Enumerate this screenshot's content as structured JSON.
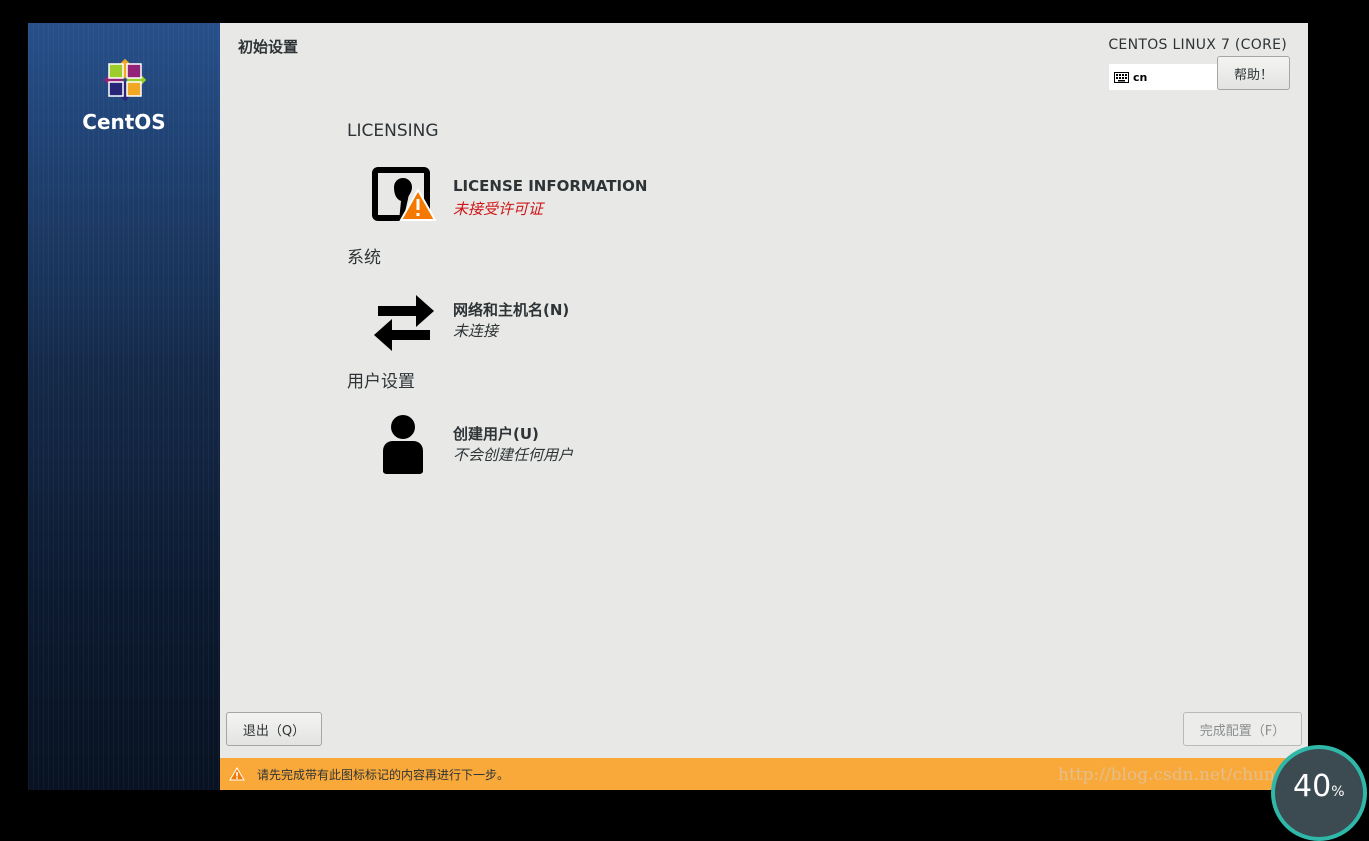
{
  "sidebar": {
    "logo_text": "CentOS"
  },
  "header": {
    "title": "初始设置",
    "distro": "CENTOS LINUX 7 (CORE)",
    "keyboard_layout": "cn",
    "help_label": "帮助！"
  },
  "categories": [
    {
      "title": "LICENSING",
      "spokes": [
        {
          "title": "LICENSE INFORMATION",
          "status": "未接受许可证",
          "icon": "license-warning-icon"
        }
      ]
    },
    {
      "title": "系统",
      "spokes": [
        {
          "title": "网络和主机名(N)",
          "status": "未连接",
          "icon": "network-arrows-icon"
        }
      ]
    },
    {
      "title": "用户设置",
      "spokes": [
        {
          "title": "创建用户(U)",
          "status": "不会创建任何用户",
          "icon": "user-icon"
        }
      ]
    }
  ],
  "footer": {
    "quit_label": "退出（Q）",
    "done_label": "完成配置（F）",
    "warning_text": "请先完成带有此图标标记的内容再进行下一步。"
  },
  "overlay": {
    "watermark": "http://blog.csdn.net/chun_long",
    "progress_value": "40",
    "progress_unit": "%"
  },
  "colors": {
    "warning_bar": "#f9a93a",
    "status_error": "#d01616",
    "sidebar": "#1e3f6e"
  }
}
